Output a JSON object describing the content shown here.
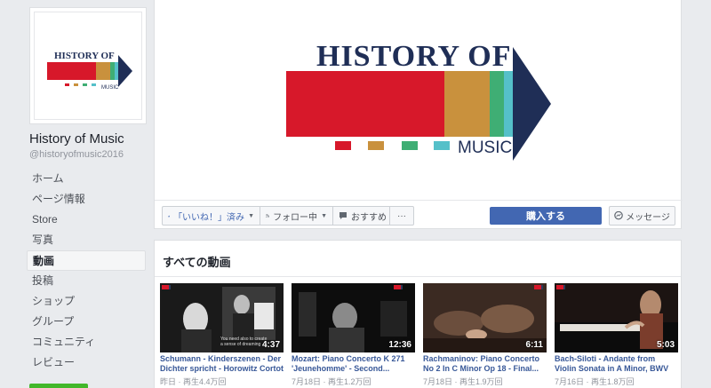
{
  "page": {
    "name": "History of Music",
    "handle": "@historyofmusic2016",
    "logo_top": "HISTORY OF",
    "logo_bottom": "MUSIC"
  },
  "nav": [
    {
      "label": "ホーム",
      "active": false
    },
    {
      "label": "ページ情報",
      "active": false
    },
    {
      "label": "Store",
      "active": false
    },
    {
      "label": "写真",
      "active": false
    },
    {
      "label": "動画",
      "active": true
    },
    {
      "label": "投稿",
      "active": false
    },
    {
      "label": "ショップ",
      "active": false
    },
    {
      "label": "グループ",
      "active": false
    },
    {
      "label": "コミュニティ",
      "active": false
    },
    {
      "label": "レビュー",
      "active": false
    }
  ],
  "actions": {
    "like": "「いいね！」済み",
    "follow": "フォロー中",
    "recommend": "おすすめ",
    "more": "···",
    "buy": "購入する",
    "message": "メッセージ"
  },
  "videos": {
    "heading": "すべての動画",
    "items": [
      {
        "title": "Schumann - Kinderszenen - Der Dichter spricht - Horowitz Cortot",
        "duration": "4:37",
        "date": "昨日",
        "views": "再生4.4万回",
        "caption": "You need also to create a sense of dreaming"
      },
      {
        "title": "Mozart: Piano Concerto K 271 'Jeunehomme' - Second...",
        "duration": "12:36",
        "date": "7月18日",
        "views": "再生1.2万回"
      },
      {
        "title": "Rachmaninov: Piano Concerto No 2 In C Minor Op 18 - Final...",
        "duration": "6:11",
        "date": "7月18日",
        "views": "再生1.9万回"
      },
      {
        "title": "Bach-Siloti - Andante from Violin Sonata in A Minor, BWV 1003 ...",
        "duration": "5:03",
        "date": "7月16日",
        "views": "再生1.8万回"
      }
    ]
  },
  "colors": {
    "brand_red": "#d7182a",
    "brand_orange": "#c9913d",
    "brand_green": "#3fae74",
    "brand_cyan": "#55c0c9",
    "brand_navy": "#1f2e56",
    "fb_blue": "#4267b2"
  }
}
